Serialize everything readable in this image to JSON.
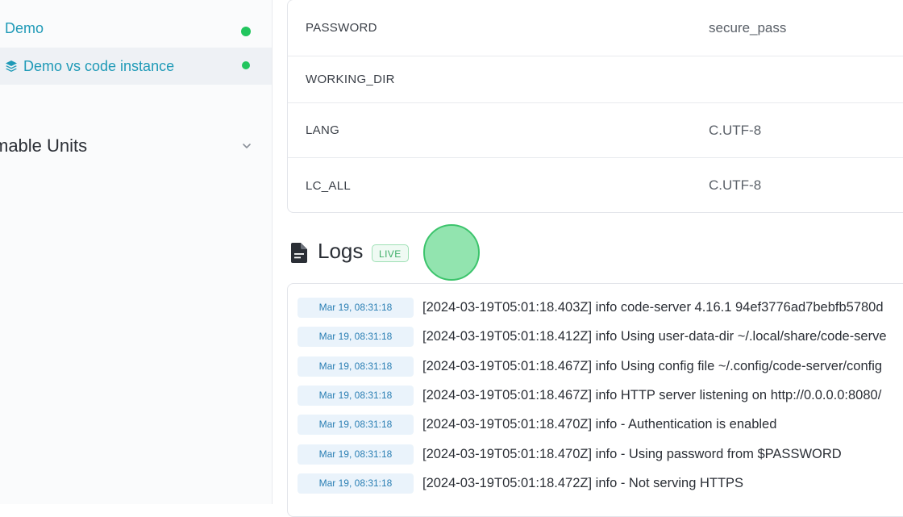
{
  "sidebar": {
    "items": [
      {
        "label": "Demo",
        "status_color": "#22c55e"
      },
      {
        "label": "Demo vs code instance",
        "status_color": "#22c55e",
        "icon": "stack-icon"
      }
    ],
    "section": {
      "label": "mable Units",
      "icon": "chevron-down-icon"
    }
  },
  "env": {
    "rows": [
      {
        "key": "PASSWORD",
        "value": "secure_pass"
      },
      {
        "key": "WORKING_DIR",
        "value": ""
      },
      {
        "key": "LANG",
        "value": "C.UTF-8"
      },
      {
        "key": "LC_ALL",
        "value": "C.UTF-8"
      }
    ]
  },
  "logs": {
    "title": "Logs",
    "badge": "LIVE",
    "icon": "document-icon",
    "entries": [
      {
        "time": "Mar 19, 08:31:18",
        "message": "[2024-03-19T05:01:18.403Z] info code-server 4.16.1 94ef3776ad7bebfb5780d"
      },
      {
        "time": "Mar 19, 08:31:18",
        "message": "[2024-03-19T05:01:18.412Z] info Using user-data-dir ~/.local/share/code-serve"
      },
      {
        "time": "Mar 19, 08:31:18",
        "message": "[2024-03-19T05:01:18.467Z] info Using config file ~/.config/code-server/config"
      },
      {
        "time": "Mar 19, 08:31:18",
        "message": "[2024-03-19T05:01:18.467Z] info HTTP server listening on http://0.0.0.0:8080/"
      },
      {
        "time": "Mar 19, 08:31:18",
        "message": "[2024-03-19T05:01:18.470Z] info - Authentication is enabled"
      },
      {
        "time": "Mar 19, 08:31:18",
        "message": "[2024-03-19T05:01:18.470Z] info - Using password from $PASSWORD"
      },
      {
        "time": "Mar 19, 08:31:18",
        "message": "[2024-03-19T05:01:18.472Z] info - Not serving HTTPS"
      }
    ]
  },
  "colors": {
    "accent": "#1f9ab7",
    "status_ok": "#22c55e",
    "live": "#3fae68"
  }
}
